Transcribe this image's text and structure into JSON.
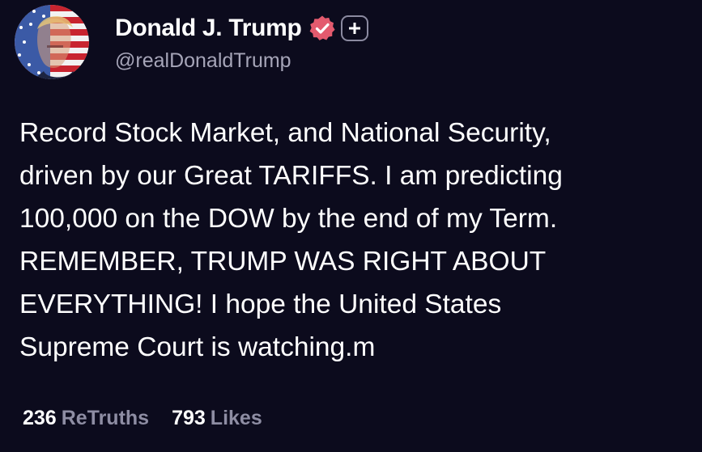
{
  "profile": {
    "display_name": "Donald J. Trump",
    "handle": "@realDonaldTrump",
    "verified_icon": "verified-badge-icon",
    "follow_icon": "plus-icon",
    "avatar": "avatar-flag-portrait"
  },
  "post": {
    "lines": [
      "Record Stock Market, and National Security,",
      "driven by our Great TARIFFS. I am predicting",
      "100,000 on the DOW by the end of my Term.",
      "REMEMBER, TRUMP WAS RIGHT ABOUT",
      "EVERYTHING! I hope the United States",
      "Supreme Court is watching.m"
    ]
  },
  "stats": {
    "retruths_count": "236",
    "retruths_label": "ReTruths",
    "likes_count": "793",
    "likes_label": "Likes"
  },
  "colors": {
    "background": "#0c0b1d",
    "text": "#ffffff",
    "muted": "#a6a5b8",
    "verified": "#e35a6e"
  }
}
